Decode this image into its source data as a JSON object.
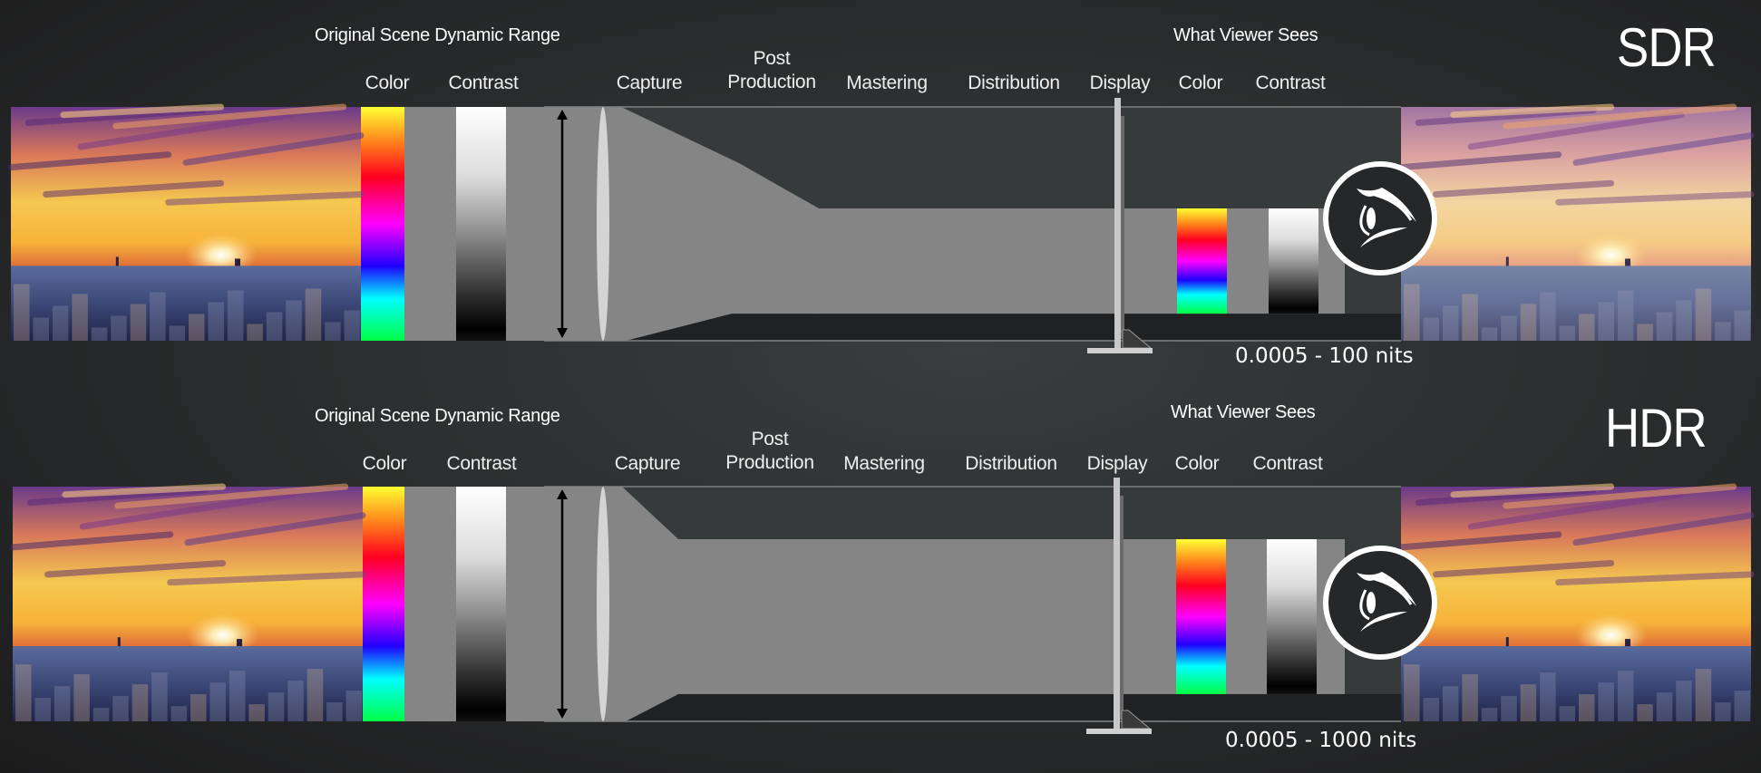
{
  "rows": [
    {
      "id": "sdr",
      "badge": "SDR",
      "original_title": "Original Scene Dynamic Range",
      "viewer_title": "What Viewer Sees",
      "input_labels": {
        "color": "Color",
        "contrast": "Contrast"
      },
      "stages": [
        {
          "line1": "",
          "line2": "Capture"
        },
        {
          "line1": "Post",
          "line2": "Production"
        },
        {
          "line1": "",
          "line2": "Mastering"
        },
        {
          "line1": "",
          "line2": "Distribution"
        },
        {
          "line1": "",
          "line2": "Display"
        }
      ],
      "output_labels": {
        "color": "Color",
        "contrast": "Contrast"
      },
      "range_text": "0.0005 - 100 nits",
      "output_range_fraction": 0.45
    },
    {
      "id": "hdr",
      "badge": "HDR",
      "original_title": "Original Scene Dynamic Range",
      "viewer_title": "What Viewer Sees",
      "input_labels": {
        "color": "Color",
        "contrast": "Contrast"
      },
      "stages": [
        {
          "line1": "",
          "line2": "Capture"
        },
        {
          "line1": "Post",
          "line2": "Production"
        },
        {
          "line1": "",
          "line2": "Mastering"
        },
        {
          "line1": "",
          "line2": "Distribution"
        },
        {
          "line1": "",
          "line2": "Display"
        }
      ],
      "output_labels": {
        "color": "Color",
        "contrast": "Contrast"
      },
      "range_text": "0.0005 - 1000 nits",
      "output_range_fraction": 0.66
    }
  ],
  "icons": {
    "photo": "city-sunset-photo",
    "arrow": "double-arrow-icon",
    "lens": "lens-icon",
    "tv": "tv-display-icon",
    "eye": "eye-icon"
  },
  "colors": {
    "pipe_gray": "#858585",
    "frame_line": "#6a6d6e",
    "upper_dark": "#363a3b",
    "lower_dark": "#202122",
    "spectrum": [
      "#ffff33",
      "#ff7a1a",
      "#ff0020",
      "#ff00ff",
      "#2000ff",
      "#00ffff",
      "#00ff44"
    ]
  }
}
